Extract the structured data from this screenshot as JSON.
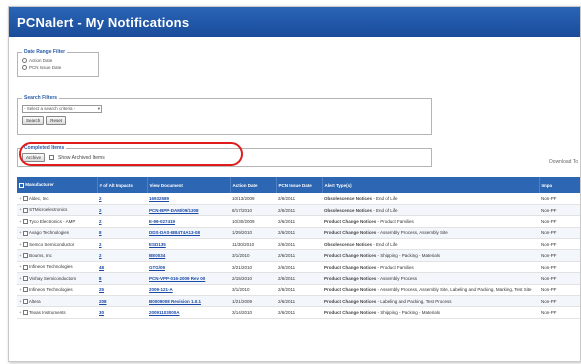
{
  "app": {
    "title": "PCNalert - My Notifications"
  },
  "date_range": {
    "legend": "Date Range Filter",
    "options": [
      "Action Date",
      "PCN Issue Date"
    ]
  },
  "search_filters": {
    "legend": "Search Filters",
    "select_value": "- Select a search criteria -",
    "search_label": "Search",
    "reset_label": "Reset"
  },
  "completed": {
    "legend": "Completed Items",
    "archive_label": "Archive",
    "show_archived_label": "Show Archived Items"
  },
  "download_text": "Download To",
  "table": {
    "headers": [
      "Manufacturer",
      "# of Alt Impacts",
      "View Document",
      "Action Date",
      "PCN Issue Date",
      "Alert Type(s)",
      "Impa"
    ],
    "rows": [
      [
        "Aldec, Inc",
        "2",
        "16932589",
        "10/13/2009",
        "2/6/2011",
        "Obsolescence Notices",
        " - End of Life",
        "Non-PF"
      ],
      [
        "STMicroelectronics",
        "2",
        "PCN-BPP-DAM/09/1308",
        "8/17/2010",
        "2/6/2011",
        "Obsolescence Notices",
        " - End of Life",
        "Non-PF"
      ],
      [
        "Tyco Electronics - AMP",
        "2",
        "E-99-027419",
        "10/30/2009",
        "2/6/2011",
        "Product Change Notices",
        " - Product Families",
        "Non-PF"
      ],
      [
        "Avago Technologies",
        "8",
        "DDS-DAS-BB4T4A13-08",
        "1/29/2010",
        "2/6/2011",
        "Product Change Notices",
        " - Assembly Process, Assembly Site",
        "Non-PF"
      ],
      [
        "Semco Semiconductor",
        "2",
        "ESD135",
        "11/30/2010",
        "2/6/2011",
        "Obsolescence Notices",
        " - End of Life",
        "Non-PF"
      ],
      [
        "Bourns, Inc",
        "2",
        "BE0034",
        "3/1/2010",
        "2/6/2011",
        "Product Change Notices",
        " - Shipping - Packing - Materials",
        "Non-PF"
      ],
      [
        "Infineon Technologies",
        "48",
        "GTG/09",
        "3/21/2010",
        "2/6/2011",
        "Product Change Notices",
        " - Product Families",
        "Non-PF"
      ],
      [
        "Vishay Semiconductors",
        "8",
        "PCN-VPP-016-2009 Rev 00",
        "2/15/2010",
        "2/6/2011",
        "Product Change Notices",
        " - Assembly Process",
        "Non-PF"
      ],
      [
        "Infineon Technologies",
        "25",
        "2009-121-A",
        "3/1/2010",
        "2/6/2011",
        "Product Change Notices",
        " - Assembly Process, Assembly Site, Labeling and Packing, Marking, Test Site",
        "Non-PF"
      ],
      [
        "Altera",
        "208",
        "B0009008 Revision 1.0.1",
        "1/21/2009",
        "2/6/2011",
        "Product Change Notices",
        " - Labeling and Packing, Test Process",
        "Non-PF"
      ],
      [
        "Texas Instruments",
        "30",
        "20091103000A",
        "3/14/2010",
        "2/6/2011",
        "Product Change Notices",
        " - Shipping - Packing - Materials",
        "Non-PF"
      ]
    ]
  },
  "icons": [
    "radio-icon",
    "checkbox-icon",
    "dropdown-arrow-icon"
  ],
  "colors": {
    "header_blue": "#2a64b6",
    "highlight_red": "#e01b1b",
    "link_blue": "#1a4aa8"
  }
}
